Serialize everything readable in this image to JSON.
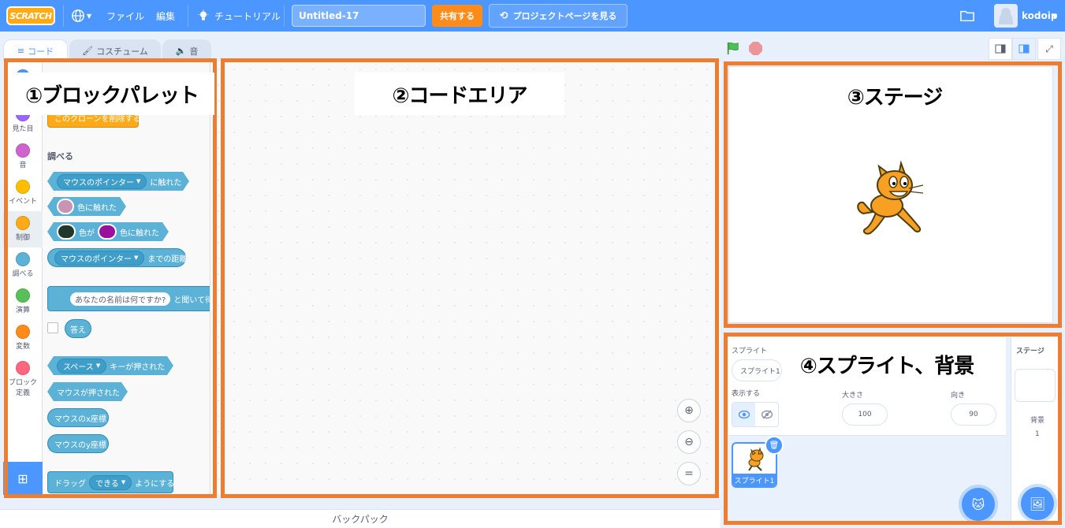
{
  "menubar": {
    "logo": "SCRATCH",
    "file": "ファイル",
    "edit": "編集",
    "tutorials": "チュートリアル",
    "project_title": "Untitled-17",
    "share": "共有する",
    "see_project_page": "プロジェクトページを見る",
    "username": "kodoip"
  },
  "tabs": {
    "code": "コード",
    "costumes": "コスチューム",
    "sounds": "音"
  },
  "categories": [
    {
      "label": "見た目",
      "color": "#9966ff"
    },
    {
      "label": "音",
      "color": "#cf63cf"
    },
    {
      "label": "イベント",
      "color": "#ffbf00"
    },
    {
      "label": "制御",
      "color": "#ffab19"
    },
    {
      "label": "調べる",
      "color": "#5cb1d6"
    },
    {
      "label": "演算",
      "color": "#59c059"
    },
    {
      "label": "変数",
      "color": "#ff8c1a"
    },
    {
      "label": "ブロック定義",
      "color": "#ff6680"
    }
  ],
  "palette": {
    "delete_clone": "このクローンを削除する",
    "sensing_header": "調べる",
    "touching_menu": "マウスのポインター",
    "touching_suffix": "に触れた",
    "touching_color": "色に触れた",
    "color_is": "色が",
    "color_touching": "色に触れた",
    "distance_menu": "マウスのポインター",
    "distance_suffix": "までの距離",
    "ask_prompt": "あなたの名前は何ですか?",
    "ask_suffix": "と聞いて待つ",
    "answer": "答え",
    "key_menu": "スペース",
    "key_suffix": "キーが押された",
    "mouse_down": "マウスが押された",
    "mouse_x": "マウスのx座標",
    "mouse_y": "マウスのy座標",
    "drag_prefix": "ドラッグ",
    "drag_menu": "できる",
    "drag_suffix": "ようにする"
  },
  "backpack": "バックパック",
  "sprite_info": {
    "sprite_label": "スプライト",
    "sprite_name": "スプライト1",
    "show_label": "表示する",
    "size_label": "大きさ",
    "size_value": "100",
    "direction_label": "向き",
    "direction_value": "90"
  },
  "sprite_list": [
    {
      "name": "スプライト1"
    }
  ],
  "stage_pane": {
    "title": "ステージ",
    "backdrops_label": "背景",
    "backdrops_count": "1"
  },
  "annotations": {
    "palette": "①ブロックパレット",
    "code": "②コードエリア",
    "stage": "③ステージ",
    "sprites": "④スプライト、背景",
    "frame_color": "#ed7d31"
  }
}
